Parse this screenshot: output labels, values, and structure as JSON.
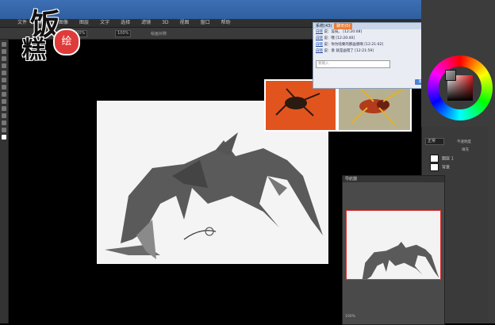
{
  "menu": [
    "文件",
    "编辑",
    "图像",
    "图层",
    "文字",
    "选择",
    "滤镜",
    "3D",
    "视图",
    "窗口",
    "帮助"
  ],
  "logo": {
    "line1": "饭",
    "line2": "糕",
    "circle_text": "绘"
  },
  "options": {
    "zoom1": "100%",
    "zoom2": "100%",
    "label": "绘画对称"
  },
  "chat": {
    "tabs": [
      "系统(43)",
      "聊天(0)"
    ],
    "messages": [
      {
        "user": "白晓",
        "text": "说：设局。 [12:20:08]"
      },
      {
        "user": "白晓",
        "text": "说：哦 [12:20:40]"
      },
      {
        "user": "白晓",
        "text": "说：你为啥要的那画感啊 [12:21:02]"
      },
      {
        "user": "白晓",
        "text": "说：诶 就是画错了 [12:21:59]"
      }
    ],
    "input_placeholder": "要输入",
    "send_label": "发送"
  },
  "layers": {
    "mode": "正常",
    "opacity_label": "不透明度",
    "fill_label": "填充",
    "items": [
      {
        "name": "图层 1"
      },
      {
        "name": "背景"
      }
    ]
  },
  "navigator": {
    "title": "导航器",
    "zoom": "100%"
  },
  "colors": {
    "titlebar": "#3d6fb4",
    "accent": "#e97e3a",
    "logo_red": "#e03a3a"
  },
  "window_controls": [
    "minimize-icon",
    "maximize-icon",
    "close-icon"
  ]
}
